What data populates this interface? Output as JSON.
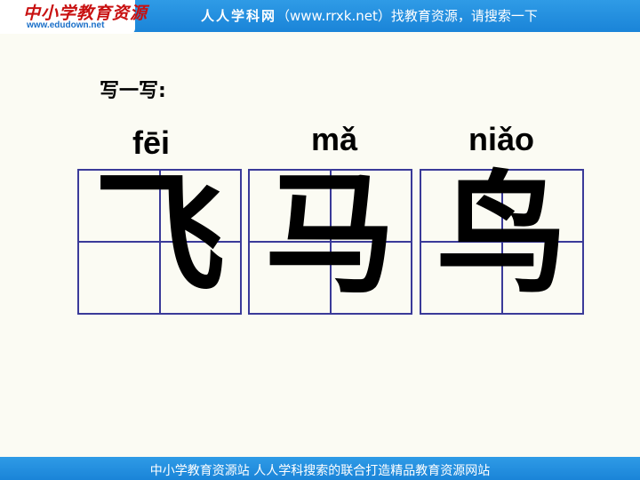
{
  "header": {
    "logo_title": "中小学教育资源",
    "logo_url": "www.edudown.net",
    "site_name": "人人学科网",
    "site_url": "（www.rrxk.net）",
    "tagline": "找教育资源，请搜索一下"
  },
  "main": {
    "instruction": "写一写:",
    "characters": [
      {
        "pinyin": "fēi",
        "hanzi": "飞"
      },
      {
        "pinyin": "mǎ",
        "hanzi": "马"
      },
      {
        "pinyin": "niǎo",
        "hanzi": "鸟"
      }
    ]
  },
  "footer": {
    "text": "中小学教育资源站 人人学科搜索的联合打造精品教育资源网站"
  },
  "colors": {
    "bar_blue": "#1a84d8",
    "logo_red": "#c81010",
    "grid_line": "#3a3a99",
    "background": "#fbfbf3"
  }
}
